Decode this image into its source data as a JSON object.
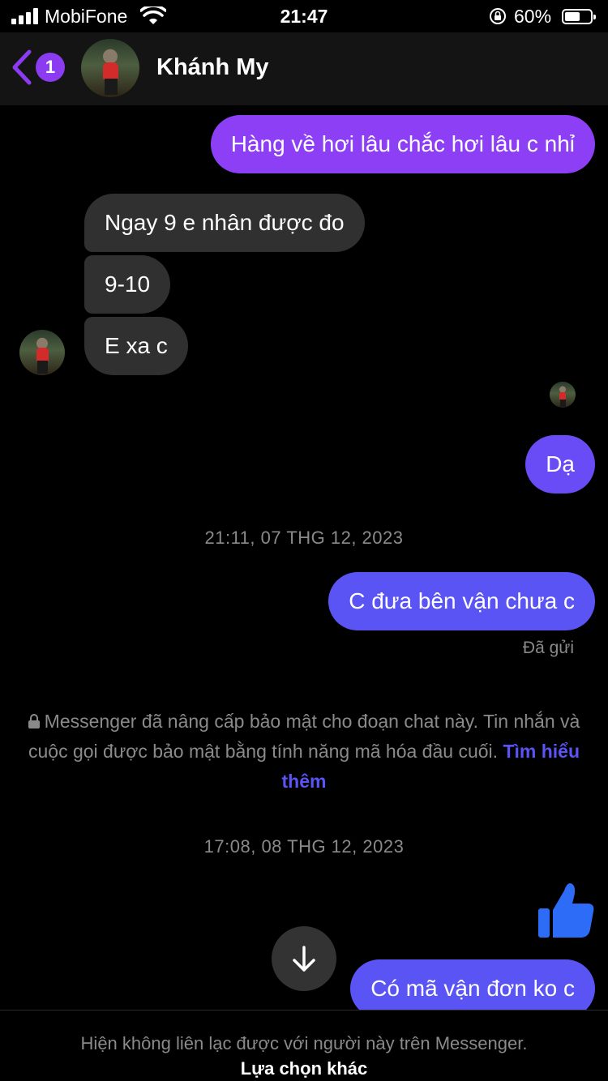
{
  "status_bar": {
    "carrier": "MobiFone",
    "time": "21:47",
    "battery_percent": "60%",
    "battery_level": 0.6
  },
  "header": {
    "unread_count": "1",
    "contact_name": "Khánh My"
  },
  "messages": [
    {
      "from": "me",
      "text": "Hàng về hơi lâu chắc hơi lâu c nhỉ"
    },
    {
      "from": "them",
      "text": "Ngay 9 e nhân được đo"
    },
    {
      "from": "them",
      "text": "9-10"
    },
    {
      "from": "them",
      "text": "E xa c"
    },
    {
      "from": "me",
      "text": "Dạ"
    },
    {
      "timestamp": "21:11, 07 THG 12, 2023"
    },
    {
      "from": "me",
      "text": "C đưa bên vận chưa c",
      "status": "Đã gửi"
    },
    {
      "timestamp": "17:08, 08 THG 12, 2023"
    },
    {
      "from": "me",
      "reaction": "thumbs-up-icon"
    },
    {
      "from": "me",
      "text": "Có mã vận đơn ko c"
    }
  ],
  "notice": {
    "text": "Messenger đã nâng cấp bảo mật cho đoạn chat này. Tin nhắn và cuộc gọi được bảo mật bằng tính năng mã hóa đầu cuối.",
    "link": "Tìm hiểu thêm"
  },
  "footer": {
    "message": "Hiện không liên lạc được với người này trên Messenger.",
    "option": "Lựa chọn khác"
  },
  "colors": {
    "accent": "#8b3cf0",
    "sent_purple": "#8d3ff5",
    "sent_blue": "#5b54f5",
    "received": "#303030"
  }
}
